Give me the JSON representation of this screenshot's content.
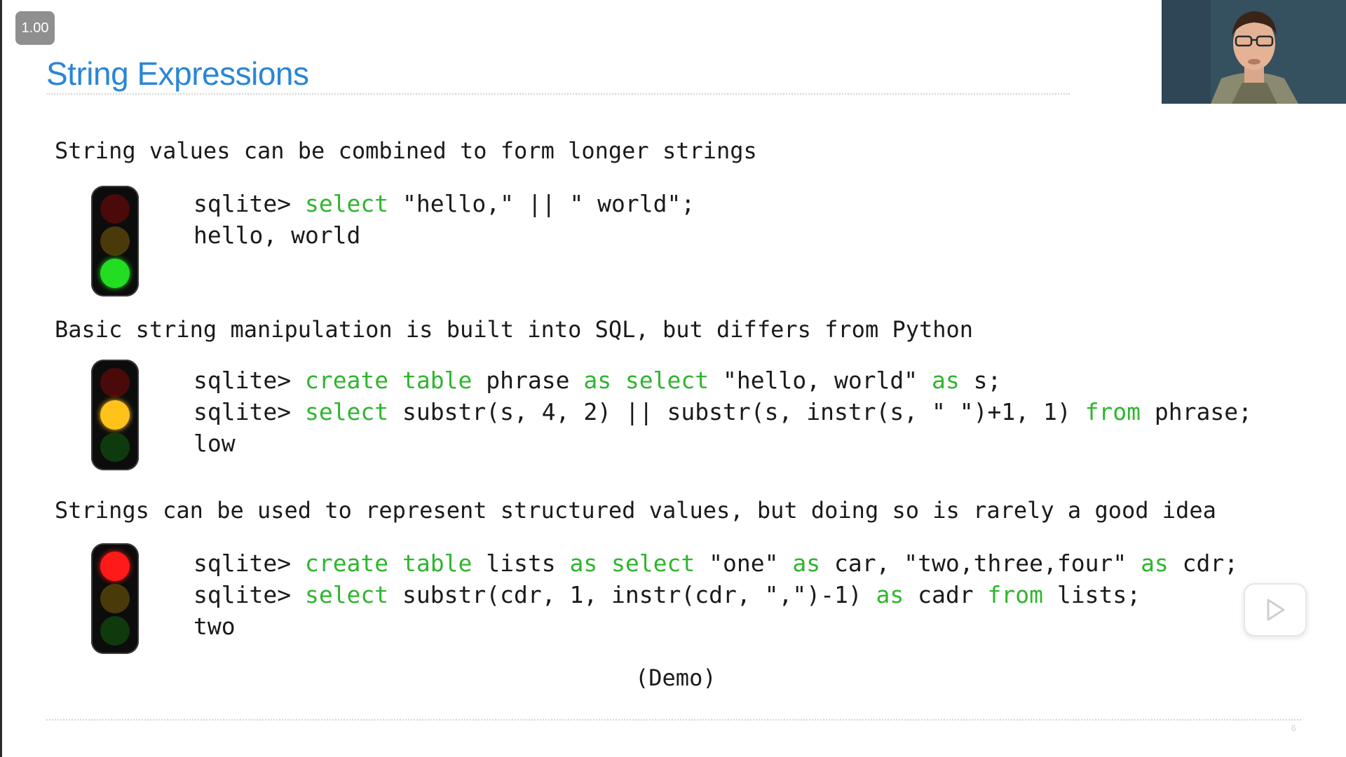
{
  "player": {
    "speed_label": "1.00"
  },
  "slide": {
    "title": "String Expressions",
    "sections": [
      {
        "heading": "String values can be combined to form longer strings",
        "light_state": "green",
        "code": [
          [
            {
              "t": "sqlite> "
            },
            {
              "t": "select",
              "kw": true
            },
            {
              "t": " \"hello,\" || \" world\";"
            }
          ],
          [
            {
              "t": "hello, world"
            }
          ]
        ]
      },
      {
        "heading": "Basic string manipulation is built into SQL, but differs from Python",
        "light_state": "yellow",
        "code": [
          [
            {
              "t": "sqlite> "
            },
            {
              "t": "create table",
              "kw": true
            },
            {
              "t": " phrase "
            },
            {
              "t": "as select",
              "kw": true
            },
            {
              "t": " \"hello, world\" "
            },
            {
              "t": "as",
              "kw": true
            },
            {
              "t": " s;"
            }
          ],
          [
            {
              "t": "sqlite> "
            },
            {
              "t": "select",
              "kw": true
            },
            {
              "t": " substr(s, 4, 2) || substr(s, instr(s, \" \")+1, 1) "
            },
            {
              "t": "from",
              "kw": true
            },
            {
              "t": " phrase;"
            }
          ],
          [
            {
              "t": "low"
            }
          ]
        ]
      },
      {
        "heading": "Strings can be used to represent structured values, but doing so is rarely a good idea",
        "light_state": "red",
        "code": [
          [
            {
              "t": "sqlite> "
            },
            {
              "t": "create table",
              "kw": true
            },
            {
              "t": " lists "
            },
            {
              "t": "as select",
              "kw": true
            },
            {
              "t": " \"one\" "
            },
            {
              "t": "as",
              "kw": true
            },
            {
              "t": " car, \"two,three,four\" "
            },
            {
              "t": "as",
              "kw": true
            },
            {
              "t": " cdr;"
            }
          ],
          [
            {
              "t": "sqlite> "
            },
            {
              "t": "select",
              "kw": true
            },
            {
              "t": " substr(cdr, 1, instr(cdr, \",\")-1) "
            },
            {
              "t": "as",
              "kw": true
            },
            {
              "t": " cadr "
            },
            {
              "t": "from",
              "kw": true
            },
            {
              "t": " lists;"
            }
          ],
          [
            {
              "t": "two"
            }
          ]
        ]
      }
    ],
    "demo_label": "(Demo)",
    "page_number": "6"
  },
  "icons": {
    "play": "play-icon",
    "traffic_light": "traffic-light-icon"
  },
  "colors": {
    "title": "#2a86d6",
    "keyword": "#2fb52f",
    "red_on": "#ff1a1a",
    "red_off": "#4a0a0a",
    "yellow_on": "#ffc21a",
    "yellow_off": "#4a3a0a",
    "green_on": "#22dd22",
    "green_off": "#0e3a0e"
  }
}
